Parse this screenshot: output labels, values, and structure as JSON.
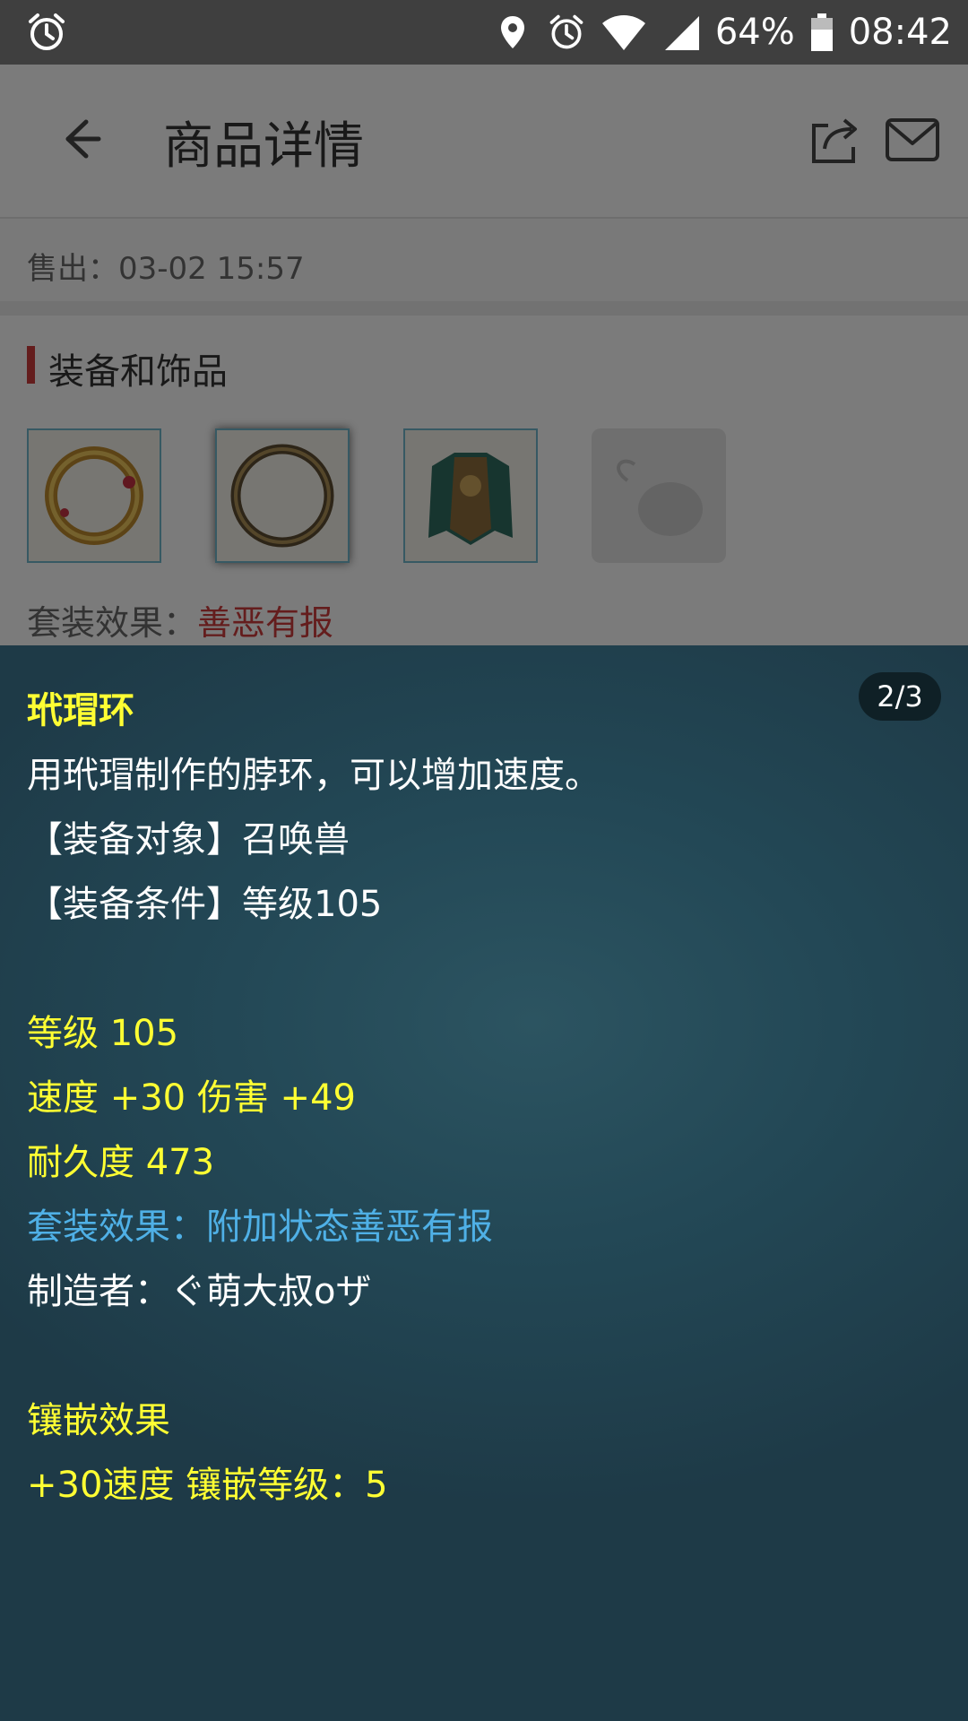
{
  "status_bar": {
    "battery_percent": "64%",
    "time": "08:42",
    "icons": [
      "alarm-icon",
      "location-icon",
      "alarm-icon",
      "wifi-icon",
      "signal-icon",
      "battery-icon"
    ]
  },
  "app_bar": {
    "title": "商品详情",
    "icons": [
      "back-arrow-icon",
      "share-icon",
      "mail-icon"
    ]
  },
  "sold": {
    "text": "售出：03-02 15:57"
  },
  "equipment": {
    "heading": "装备和饰品",
    "slots": [
      {
        "name": "ring-item",
        "state": "item"
      },
      {
        "name": "collar-item",
        "state": "item-selected"
      },
      {
        "name": "armor-item",
        "state": "item"
      },
      {
        "name": "empty-slot",
        "state": "empty"
      }
    ],
    "set_label": "套装效果：",
    "set_value": "善恶有报"
  },
  "tooltip": {
    "page_indicator": "2/3",
    "item_name": "玳瑁环",
    "description": "用玳瑁制作的脖环，可以增加速度。",
    "equip_target": "【装备对象】召唤兽",
    "equip_condition": "【装备条件】等级105",
    "level": "等级 105",
    "stats": "速度 +30 伤害 +49",
    "durability": "耐久度 473",
    "set_effect": "套装效果：附加状态善恶有报",
    "maker": "制造者：ぐ萌大叔oザ",
    "inlay_title": "镶嵌效果",
    "inlay_detail": "+30速度 镶嵌等级：5"
  },
  "colors": {
    "accent_red": "#c83a3a",
    "tooltip_yellow": "#ffff33",
    "tooltip_blue": "#4fb0e6",
    "tooltip_bg": "#234856"
  }
}
